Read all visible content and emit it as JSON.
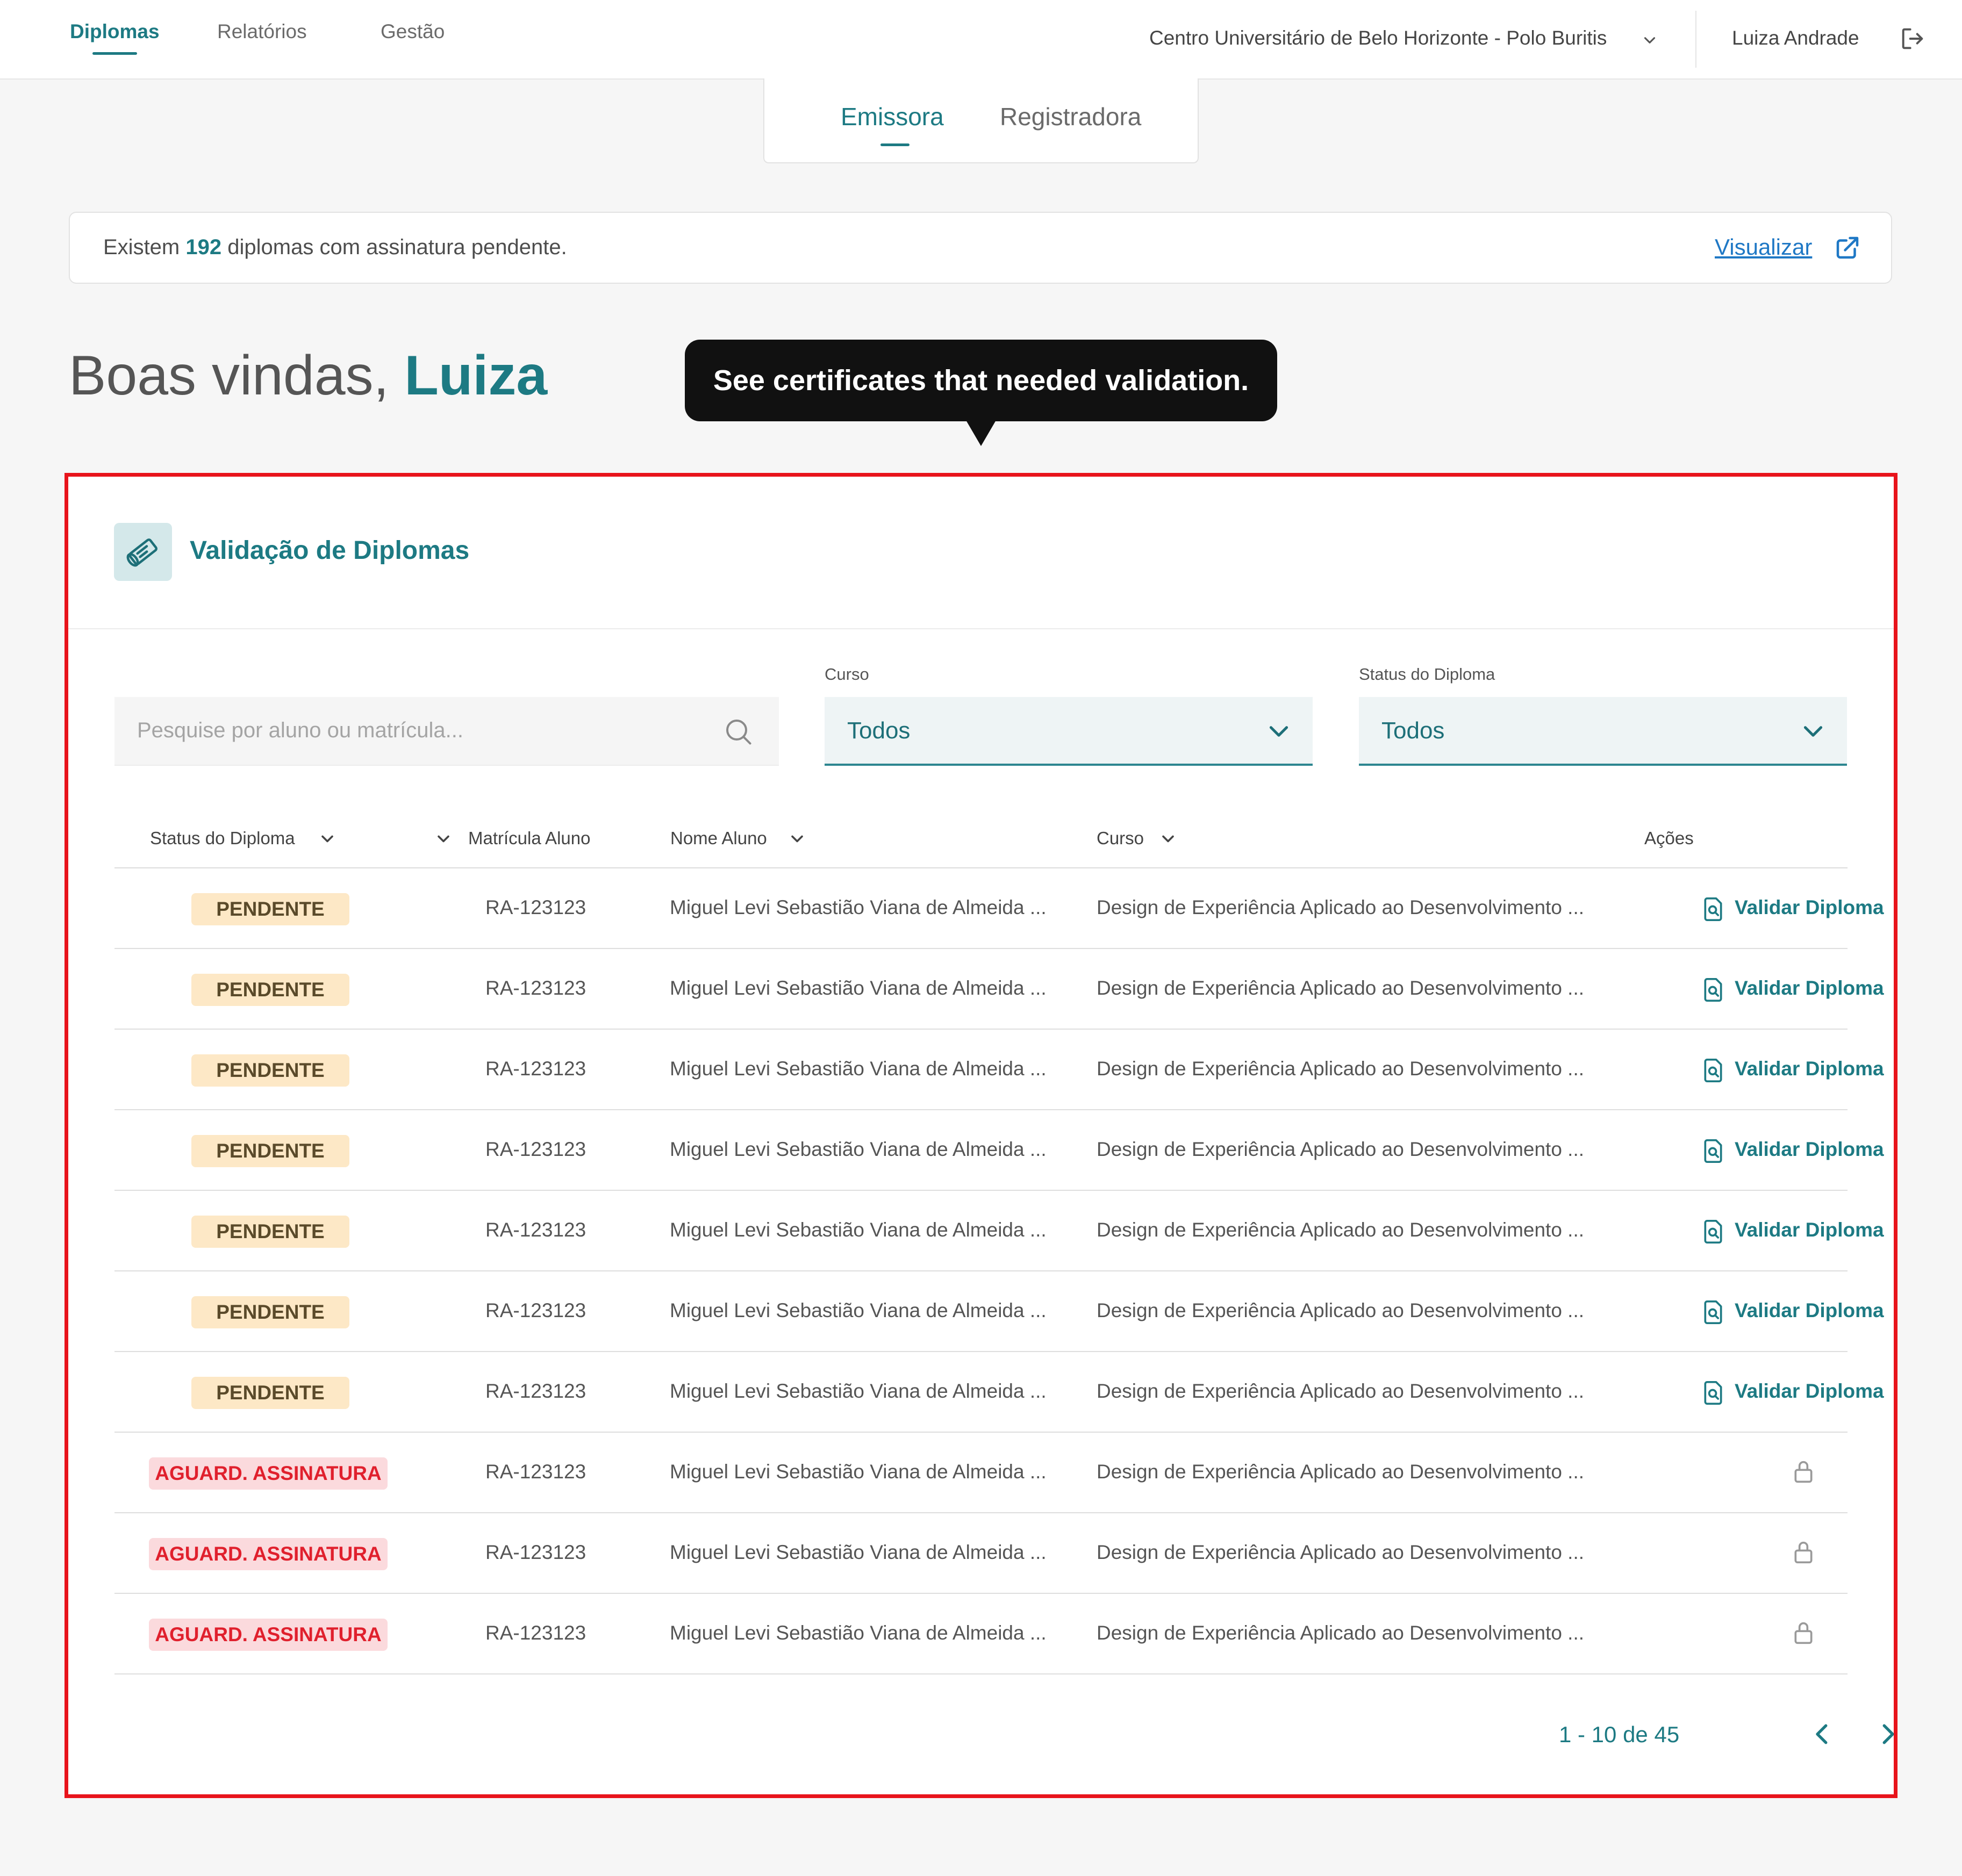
{
  "nav": {
    "items": [
      {
        "label": "Diplomas",
        "active": true
      },
      {
        "label": "Relatórios",
        "active": false
      },
      {
        "label": "Gestão",
        "active": false
      }
    ],
    "campus": "Centro Universitário de Belo Horizonte - Polo Buritis",
    "user": "Luiza Andrade",
    "icons": {
      "campus_dropdown": "chevron-down-icon",
      "logout": "logout-icon"
    }
  },
  "switch": {
    "tabs": [
      {
        "label": "Emissora",
        "active": true
      },
      {
        "label": "Registradora",
        "active": false
      }
    ]
  },
  "banner": {
    "prefix": "Existem",
    "count": "192",
    "suffix": "diplomas com assinatura pendente.",
    "link_label": "Visualizar",
    "link_icon": "external-link-icon"
  },
  "welcome": {
    "greeting": "Boas vindas,",
    "name": "Luiza"
  },
  "tooltip": {
    "text": "See certificates that needed validation."
  },
  "card": {
    "title": "Validação de Diplomas",
    "icon": "diploma-scroll-icon",
    "search": {
      "placeholder": "Pesquise por aluno ou matrícula...",
      "value": ""
    },
    "filters": [
      {
        "label": "Curso",
        "value": "Todos"
      },
      {
        "label": "Status do Diploma",
        "value": "Todos"
      }
    ],
    "table": {
      "headers": {
        "status": "Status do Diploma",
        "matricula": "Matrícula Aluno",
        "nome": "Nome Aluno",
        "curso": "Curso",
        "acoes": "Ações"
      },
      "rows": [
        {
          "status": "PENDENTE",
          "status_kind": "pendente",
          "ra": "RA-123123",
          "nome": "Miguel Levi Sebastião Viana de Almeida ...",
          "curso": "Design de Experiência Aplicado ao Desenvolvimento ...",
          "action": "Validar Diploma"
        },
        {
          "status": "PENDENTE",
          "status_kind": "pendente",
          "ra": "RA-123123",
          "nome": "Miguel Levi Sebastião Viana de Almeida ...",
          "curso": "Design de Experiência Aplicado ao Desenvolvimento ...",
          "action": "Validar Diploma"
        },
        {
          "status": "PENDENTE",
          "status_kind": "pendente",
          "ra": "RA-123123",
          "nome": "Miguel Levi Sebastião Viana de Almeida ...",
          "curso": "Design de Experiência Aplicado ao Desenvolvimento ...",
          "action": "Validar Diploma"
        },
        {
          "status": "PENDENTE",
          "status_kind": "pendente",
          "ra": "RA-123123",
          "nome": "Miguel Levi Sebastião Viana de Almeida ...",
          "curso": "Design de Experiência Aplicado ao Desenvolvimento ...",
          "action": "Validar Diploma"
        },
        {
          "status": "PENDENTE",
          "status_kind": "pendente",
          "ra": "RA-123123",
          "nome": "Miguel Levi Sebastião Viana de Almeida ...",
          "curso": "Design de Experiência Aplicado ao Desenvolvimento ...",
          "action": "Validar Diploma"
        },
        {
          "status": "PENDENTE",
          "status_kind": "pendente",
          "ra": "RA-123123",
          "nome": "Miguel Levi Sebastião Viana de Almeida ...",
          "curso": "Design de Experiência Aplicado ao Desenvolvimento ...",
          "action": "Validar Diploma"
        },
        {
          "status": "PENDENTE",
          "status_kind": "pendente",
          "ra": "RA-123123",
          "nome": "Miguel Levi Sebastião Viana de Almeida ...",
          "curso": "Design de Experiência Aplicado ao Desenvolvimento ...",
          "action": "Validar Diploma"
        },
        {
          "status": "AGUARD. ASSINATURA",
          "status_kind": "aguard",
          "ra": "RA-123123",
          "nome": "Miguel Levi Sebastião Viana de Almeida ...",
          "curso": "Design de Experiência Aplicado ao Desenvolvimento ...",
          "action": null
        },
        {
          "status": "AGUARD. ASSINATURA",
          "status_kind": "aguard",
          "ra": "RA-123123",
          "nome": "Miguel Levi Sebastião Viana de Almeida ...",
          "curso": "Design de Experiência Aplicado ao Desenvolvimento ...",
          "action": null
        },
        {
          "status": "AGUARD. ASSINATURA",
          "status_kind": "aguard",
          "ra": "RA-123123",
          "nome": "Miguel Levi Sebastião Viana de Almeida ...",
          "curso": "Design de Experiência Aplicado ao Desenvolvimento ...",
          "action": null
        }
      ]
    },
    "pagination": {
      "text": "1 - 10 de 45",
      "prev_icon": "chevron-left-icon",
      "next_icon": "chevron-right-icon"
    }
  },
  "colors": {
    "accent": "#1d7a83",
    "link": "#1f78c5",
    "pendente_bg": "#fde8c6",
    "aguard_bg": "#fbdadd",
    "aguard_text": "#e0202d",
    "highlight_border": "#e8141b",
    "tooltip_bg": "#111111"
  }
}
